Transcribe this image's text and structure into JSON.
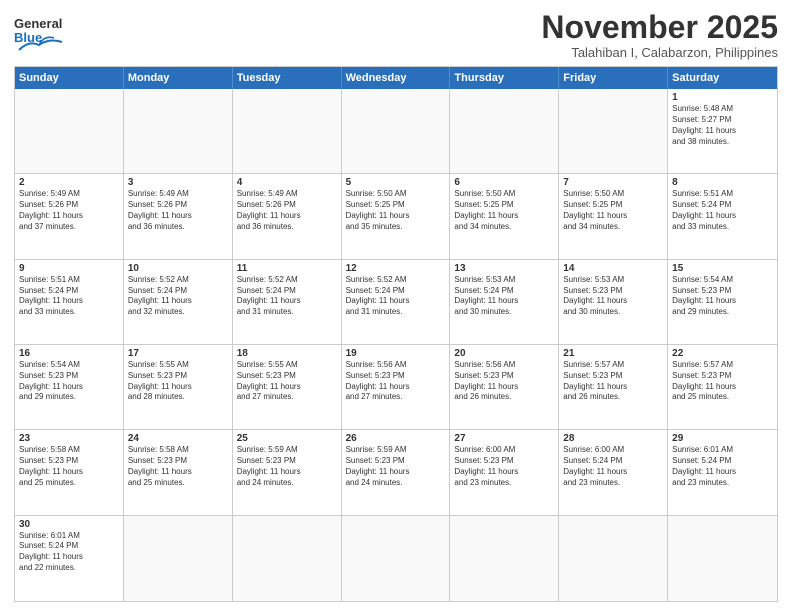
{
  "header": {
    "logo_general": "General",
    "logo_blue": "Blue",
    "month_title": "November 2025",
    "subtitle": "Talahiban I, Calabarzon, Philippines"
  },
  "days_of_week": [
    "Sunday",
    "Monday",
    "Tuesday",
    "Wednesday",
    "Thursday",
    "Friday",
    "Saturday"
  ],
  "weeks": [
    [
      {
        "day": "",
        "info": ""
      },
      {
        "day": "",
        "info": ""
      },
      {
        "day": "",
        "info": ""
      },
      {
        "day": "",
        "info": ""
      },
      {
        "day": "",
        "info": ""
      },
      {
        "day": "",
        "info": ""
      },
      {
        "day": "1",
        "info": "Sunrise: 5:48 AM\nSunset: 5:27 PM\nDaylight: 11 hours\nand 38 minutes."
      }
    ],
    [
      {
        "day": "2",
        "info": "Sunrise: 5:49 AM\nSunset: 5:26 PM\nDaylight: 11 hours\nand 37 minutes."
      },
      {
        "day": "3",
        "info": "Sunrise: 5:49 AM\nSunset: 5:26 PM\nDaylight: 11 hours\nand 36 minutes."
      },
      {
        "day": "4",
        "info": "Sunrise: 5:49 AM\nSunset: 5:26 PM\nDaylight: 11 hours\nand 36 minutes."
      },
      {
        "day": "5",
        "info": "Sunrise: 5:50 AM\nSunset: 5:25 PM\nDaylight: 11 hours\nand 35 minutes."
      },
      {
        "day": "6",
        "info": "Sunrise: 5:50 AM\nSunset: 5:25 PM\nDaylight: 11 hours\nand 34 minutes."
      },
      {
        "day": "7",
        "info": "Sunrise: 5:50 AM\nSunset: 5:25 PM\nDaylight: 11 hours\nand 34 minutes."
      },
      {
        "day": "8",
        "info": "Sunrise: 5:51 AM\nSunset: 5:24 PM\nDaylight: 11 hours\nand 33 minutes."
      }
    ],
    [
      {
        "day": "9",
        "info": "Sunrise: 5:51 AM\nSunset: 5:24 PM\nDaylight: 11 hours\nand 33 minutes."
      },
      {
        "day": "10",
        "info": "Sunrise: 5:52 AM\nSunset: 5:24 PM\nDaylight: 11 hours\nand 32 minutes."
      },
      {
        "day": "11",
        "info": "Sunrise: 5:52 AM\nSunset: 5:24 PM\nDaylight: 11 hours\nand 31 minutes."
      },
      {
        "day": "12",
        "info": "Sunrise: 5:52 AM\nSunset: 5:24 PM\nDaylight: 11 hours\nand 31 minutes."
      },
      {
        "day": "13",
        "info": "Sunrise: 5:53 AM\nSunset: 5:24 PM\nDaylight: 11 hours\nand 30 minutes."
      },
      {
        "day": "14",
        "info": "Sunrise: 5:53 AM\nSunset: 5:23 PM\nDaylight: 11 hours\nand 30 minutes."
      },
      {
        "day": "15",
        "info": "Sunrise: 5:54 AM\nSunset: 5:23 PM\nDaylight: 11 hours\nand 29 minutes."
      }
    ],
    [
      {
        "day": "16",
        "info": "Sunrise: 5:54 AM\nSunset: 5:23 PM\nDaylight: 11 hours\nand 29 minutes."
      },
      {
        "day": "17",
        "info": "Sunrise: 5:55 AM\nSunset: 5:23 PM\nDaylight: 11 hours\nand 28 minutes."
      },
      {
        "day": "18",
        "info": "Sunrise: 5:55 AM\nSunset: 5:23 PM\nDaylight: 11 hours\nand 27 minutes."
      },
      {
        "day": "19",
        "info": "Sunrise: 5:56 AM\nSunset: 5:23 PM\nDaylight: 11 hours\nand 27 minutes."
      },
      {
        "day": "20",
        "info": "Sunrise: 5:56 AM\nSunset: 5:23 PM\nDaylight: 11 hours\nand 26 minutes."
      },
      {
        "day": "21",
        "info": "Sunrise: 5:57 AM\nSunset: 5:23 PM\nDaylight: 11 hours\nand 26 minutes."
      },
      {
        "day": "22",
        "info": "Sunrise: 5:57 AM\nSunset: 5:23 PM\nDaylight: 11 hours\nand 25 minutes."
      }
    ],
    [
      {
        "day": "23",
        "info": "Sunrise: 5:58 AM\nSunset: 5:23 PM\nDaylight: 11 hours\nand 25 minutes."
      },
      {
        "day": "24",
        "info": "Sunrise: 5:58 AM\nSunset: 5:23 PM\nDaylight: 11 hours\nand 25 minutes."
      },
      {
        "day": "25",
        "info": "Sunrise: 5:59 AM\nSunset: 5:23 PM\nDaylight: 11 hours\nand 24 minutes."
      },
      {
        "day": "26",
        "info": "Sunrise: 5:59 AM\nSunset: 5:23 PM\nDaylight: 11 hours\nand 24 minutes."
      },
      {
        "day": "27",
        "info": "Sunrise: 6:00 AM\nSunset: 5:23 PM\nDaylight: 11 hours\nand 23 minutes."
      },
      {
        "day": "28",
        "info": "Sunrise: 6:00 AM\nSunset: 5:24 PM\nDaylight: 11 hours\nand 23 minutes."
      },
      {
        "day": "29",
        "info": "Sunrise: 6:01 AM\nSunset: 5:24 PM\nDaylight: 11 hours\nand 23 minutes."
      }
    ],
    [
      {
        "day": "30",
        "info": "Sunrise: 6:01 AM\nSunset: 5:24 PM\nDaylight: 11 hours\nand 22 minutes."
      },
      {
        "day": "",
        "info": ""
      },
      {
        "day": "",
        "info": ""
      },
      {
        "day": "",
        "info": ""
      },
      {
        "day": "",
        "info": ""
      },
      {
        "day": "",
        "info": ""
      },
      {
        "day": "",
        "info": ""
      }
    ]
  ]
}
